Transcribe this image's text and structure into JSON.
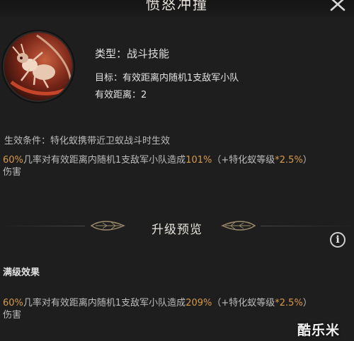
{
  "header": {
    "title": "愤怒冲撞"
  },
  "skill": {
    "icon": "ant-warrior-icon",
    "type_line": "类型：战斗技能",
    "target_line": "目标：有效距离内随机1支敌军小队",
    "range_line": "有效距离：2",
    "condition_line": "生效条件：特化蚁携带近卫蚁战斗时生效",
    "effect": {
      "prefix_pct": "60%",
      "mid": "几率对有效距离内随机1支敌军小队造成",
      "value": "101%",
      "formula_pre": "（+特化蚁等级",
      "formula_mult": "*2.5%",
      "formula_post": "）",
      "tail": "伤害"
    }
  },
  "upgrade": {
    "title": "升级预览",
    "info_icon": "info-icon",
    "max_label": "满级效果",
    "effect": {
      "prefix_pct": "60%",
      "mid": "几率对有效距离内随机1支敌军小队造成",
      "value": "209%",
      "formula_pre": "（+特化蚁等级",
      "formula_mult": "*2.5%",
      "formula_post": "）",
      "tail": "伤害"
    }
  },
  "watermark": "酷乐米",
  "colors": {
    "highlight": "#d89a4a",
    "background": "#1e1e1f",
    "text": "#e2e2e2"
  }
}
